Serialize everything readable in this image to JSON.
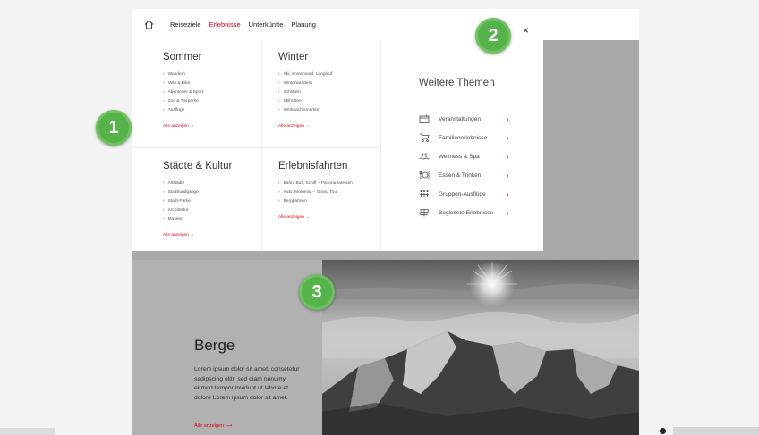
{
  "nav": {
    "items": [
      "Reiseziele",
      "Erlebnisse",
      "Unterkünfte",
      "Planung"
    ],
    "active": "Erlebnisse"
  },
  "menu": {
    "columns": [
      {
        "title": "Sommer",
        "items": [
          "Wandern",
          "Velo & Bike",
          "Abenteuer & Sport",
          "Zoo & Tierpärke",
          "Ausflüge"
        ],
        "all": "Alle anzeigen  →"
      },
      {
        "title": "Winter",
        "items": [
          "Ski, Snowboard, Langlauf",
          "Winterwandern",
          "Schlitteln",
          "Skihütten",
          "Weihnachtsmärkte"
        ],
        "all": "Alle anzeigen  →"
      },
      {
        "title": "Städte & Kultur",
        "items": [
          "Altstädte",
          "Stadtrundgänge",
          "Stadt-Pärke",
          "Architektur",
          "Museen"
        ],
        "all": "Alle anzeigen  →"
      },
      {
        "title": "Erlebnisfahrten",
        "items": [
          "Bahn, Bus, Schiff – Panoramareisen",
          "Auto, Motorrad – Grand Tour",
          "Bergbahnen"
        ],
        "all": "Alle anzeigen  →"
      }
    ]
  },
  "themes": {
    "title": "Weitere Themen",
    "items": [
      {
        "label": "Veranstaltungen",
        "icon": "calendar-icon"
      },
      {
        "label": "Familienerlebnisse",
        "icon": "stroller-icon"
      },
      {
        "label": "Wellness & Spa",
        "icon": "pool-icon"
      },
      {
        "label": "Essen & Trinken",
        "icon": "dining-icon"
      },
      {
        "label": "Gruppen-Ausflüge",
        "icon": "group-icon"
      },
      {
        "label": "Begleitete Erlebnisse",
        "icon": "signpost-icon"
      }
    ]
  },
  "close_label": "×",
  "teaser": {
    "title": "Berge",
    "text": "Lorem ipsum dolor sit amet, consetetur sadipscing elitr, sed diam nonumy eirmod tempor invidunt ut labore et dolore Lorem ipsum dolor sit amet.",
    "link": "Alle anzeigen  ⟶"
  },
  "badges": [
    "1",
    "2",
    "3"
  ],
  "colors": {
    "accent": "#e2001a",
    "badge": "#56b24a"
  }
}
